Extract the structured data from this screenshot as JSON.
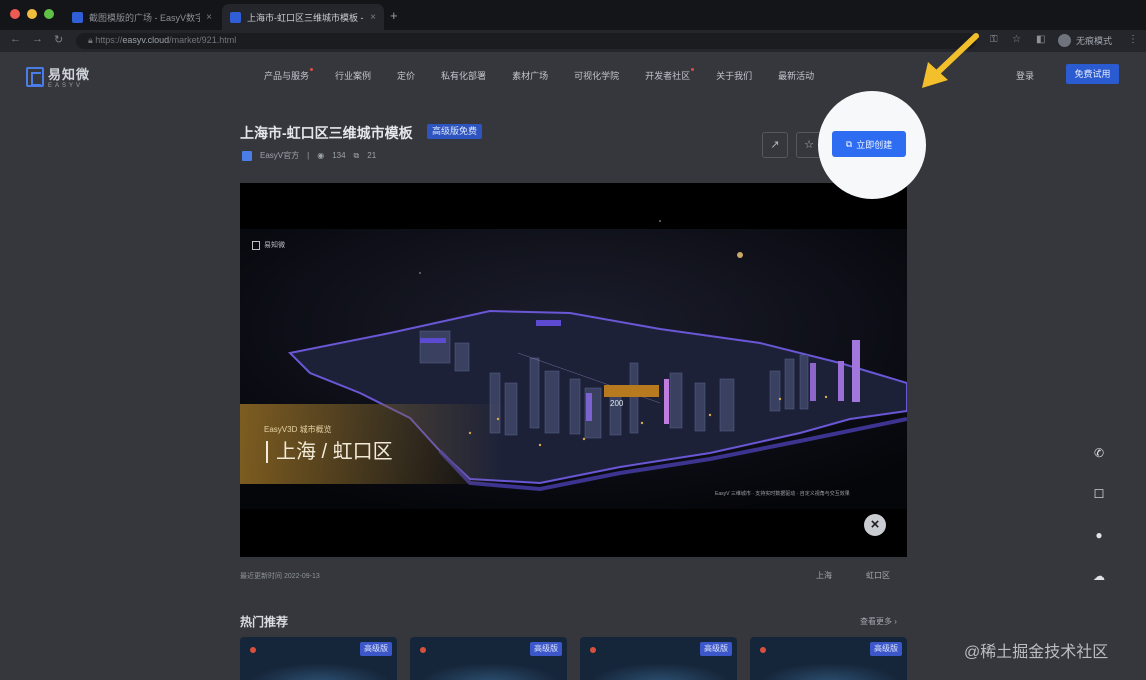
{
  "browser": {
    "tabs": [
      {
        "title": "截图模版的广场 - EasyV数字孪生",
        "active": false
      },
      {
        "title": "上海市-虹口区三维城市模板 - E",
        "active": true
      }
    ],
    "new_tab": "+",
    "close_glyph": "×",
    "url_scheme": "https://",
    "url_host": "easyv.cloud",
    "url_path": "/market/921.html",
    "profile_label": "无痕模式",
    "nav_icons": [
      "back-icon",
      "forward-icon",
      "reload-icon"
    ]
  },
  "site": {
    "logo_cn": "易知微",
    "logo_en": "EASYV",
    "nav": [
      {
        "label": "产品与服务",
        "dot": true
      },
      {
        "label": "行业案例",
        "dot": false
      },
      {
        "label": "定价",
        "dot": false
      },
      {
        "label": "私有化部署",
        "dot": false
      },
      {
        "label": "素材广场",
        "dot": false
      },
      {
        "label": "可视化学院",
        "dot": false
      },
      {
        "label": "开发者社区",
        "dot": true
      },
      {
        "label": "关于我们",
        "dot": false
      },
      {
        "label": "最新活动",
        "dot": false
      }
    ],
    "login": "登录",
    "trial": "免费试用"
  },
  "template": {
    "title": "上海市-虹口区三维城市模板",
    "badge": "高级版免费",
    "author": "EasyV官方",
    "views": "134",
    "copies": "21",
    "use_button": "立即创建",
    "share_icon": "share-icon",
    "star_icon": "star-icon"
  },
  "preview": {
    "logo_text": "易知微",
    "banner_sub": "EasyV3D 城市概览",
    "banner_main": "上海 / 虹口区",
    "tooltip_value": "200",
    "caption": "EasyV 三维城市 · 支持实时数据驱动 · 自定义视角与交互效果",
    "close_icon": "close-icon"
  },
  "footer": {
    "updated": "最近更新时间 2022-09-13",
    "left_link": "上海",
    "right_link": "虹口区"
  },
  "recommend": {
    "title": "热门推荐",
    "more": "查看更多 ›",
    "cards": [
      {
        "tag": "高级版"
      },
      {
        "tag": "高级版"
      },
      {
        "tag": "高级版"
      },
      {
        "tag": "高级版"
      }
    ]
  },
  "sidebar_icons": [
    "phone-icon",
    "trial-icon",
    "chat-icon",
    "wechat-icon"
  ],
  "watermark": "@稀土掘金技术社区",
  "colors": {
    "accent": "#2e6df2",
    "spotlight": "#f7f8fa",
    "arrow": "#f3c02b",
    "dim_page": "#35373c"
  }
}
